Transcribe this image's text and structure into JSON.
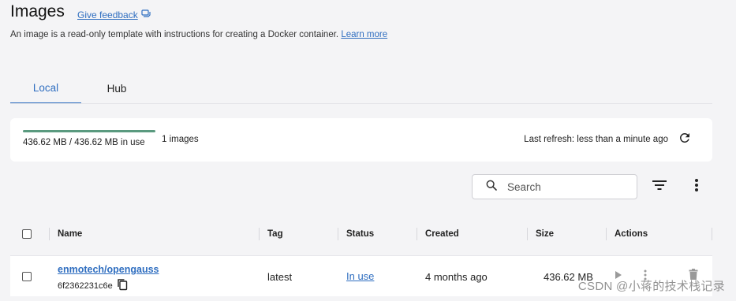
{
  "header": {
    "title": "Images",
    "feedback_label": "Give feedback",
    "subtitle": "An image is a read-only template with instructions for creating a Docker container.",
    "learn_more": "Learn more"
  },
  "tabs": [
    {
      "label": "Local",
      "active": true
    },
    {
      "label": "Hub",
      "active": false
    }
  ],
  "usage": {
    "text": "436.62 MB / 436.62 MB in use",
    "used_fraction": 1.0,
    "image_count": "1 images",
    "last_refresh": "Last refresh: less than a minute ago"
  },
  "search": {
    "placeholder": "Search",
    "value": ""
  },
  "table": {
    "columns": {
      "name": "Name",
      "tag": "Tag",
      "status": "Status",
      "created": "Created",
      "size": "Size",
      "actions": "Actions"
    },
    "rows": [
      {
        "name": "enmotech/opengauss",
        "id": "6f2362231c6e",
        "tag": "latest",
        "status": "In use",
        "created": "4 months ago",
        "size": "436.62 MB"
      }
    ]
  },
  "watermark": "CSDN @小蒋的技术栈记录",
  "colors": {
    "accent": "#2f6ec0",
    "usage_bar": "#5a9a7f",
    "background": "#f4f4f6"
  },
  "icons": [
    "feedback-icon",
    "refresh-icon",
    "search-icon",
    "filter-icon",
    "more-vert-icon",
    "copy-icon",
    "play-icon",
    "delete-icon"
  ]
}
